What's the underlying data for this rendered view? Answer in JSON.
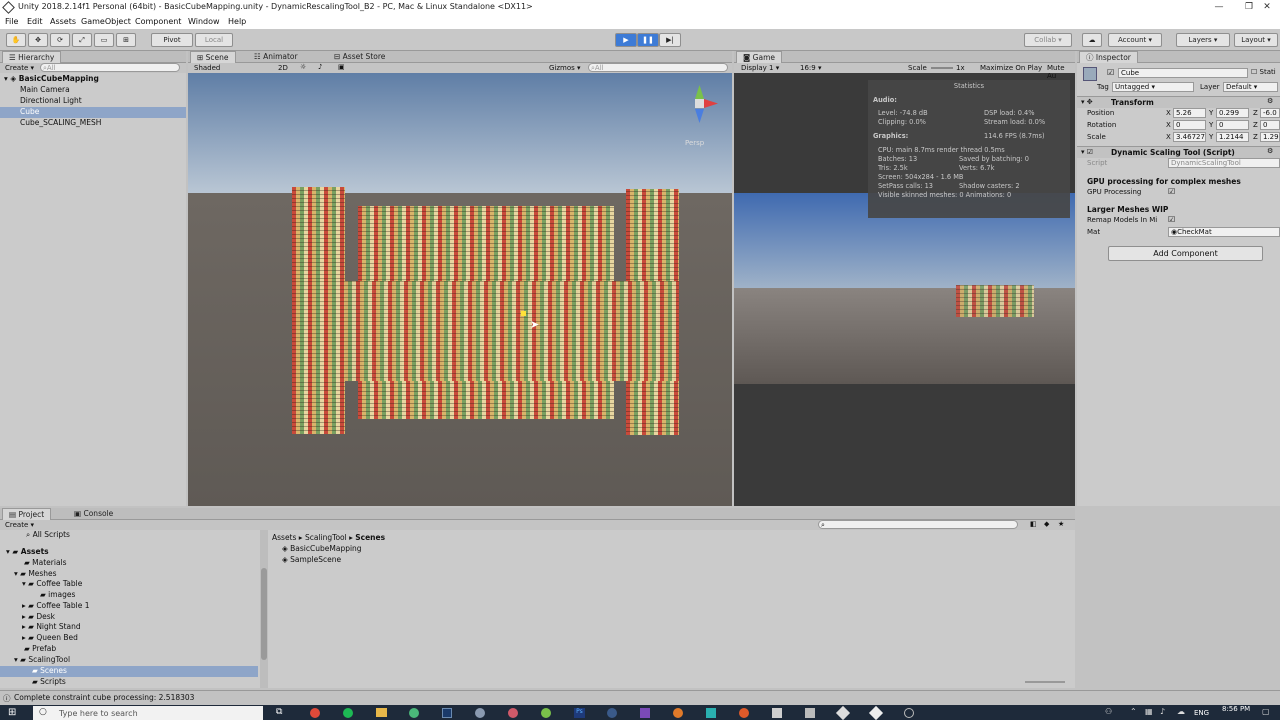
{
  "window": {
    "title": "Unity 2018.2.14f1 Personal (64bit) - BasicCubeMapping.unity - DynamicRescalingTool_B2 - PC, Mac & Linux Standalone <DX11>",
    "minimize": "—",
    "maximize": "❐",
    "close": "✕"
  },
  "menu": [
    "File",
    "Edit",
    "Assets",
    "GameObject",
    "Component",
    "Window",
    "Help"
  ],
  "toolbar": {
    "pivot": "Pivot",
    "local": "Local",
    "collab": "Collab ▾",
    "account": "Account",
    "layers": "Layers",
    "layout": "Layout"
  },
  "hierarchy": {
    "tab": "Hierarchy",
    "create": "Create",
    "search_placeholder": "All",
    "scene": "BasicCubeMapping",
    "items": [
      "Main Camera",
      "Directional Light",
      "Cube",
      "Cube_SCALING_MESH"
    ],
    "selected_index": 2
  },
  "scene_view": {
    "tabs": [
      "Scene",
      "Animator",
      "Asset Store"
    ],
    "shading": "Shaded",
    "mode_2d": "2D",
    "gizmos": "Gizmos",
    "search_placeholder": "All",
    "persp": "Persp"
  },
  "game_view": {
    "tab": "Game",
    "display": "Display 1",
    "aspect": "16:9",
    "scale_label": "Scale",
    "scale_value": "1x",
    "maximize": "Maximize On Play",
    "mute": "Mute Au"
  },
  "statistics": {
    "title": "Statistics",
    "audio_label": "Audio:",
    "level": "Level: -74.8 dB",
    "clipping": "Clipping: 0.0%",
    "dsp": "DSP load: 0.4%",
    "stream": "Stream load: 0.0%",
    "graphics_label": "Graphics:",
    "fps": "114.6 FPS (8.7ms)",
    "cpu": "CPU: main 8.7ms  render thread 0.5ms",
    "batches": "Batches: 13",
    "saved_batching": "Saved by batching: 0",
    "tris": "Tris: 2.5k",
    "verts": "Verts: 6.7k",
    "screen": "Screen: 504x284 - 1.6 MB",
    "setpass": "SetPass calls: 13",
    "shadow": "Shadow casters: 2",
    "skinned": "Visible skinned meshes: 0  Animations: 0"
  },
  "inspector": {
    "tab": "Inspector",
    "object_name": "Cube",
    "static": "Stati",
    "tag_label": "Tag",
    "tag_value": "Untagged",
    "layer_label": "Layer",
    "layer_value": "Default",
    "transform_title": "Transform",
    "position_label": "Position",
    "rotation_label": "Rotation",
    "scale_label": "Scale",
    "position": {
      "x": "5.26",
      "y": "0.299",
      "z": "-6.0"
    },
    "rotation": {
      "x": "0",
      "y": "0",
      "z": "0"
    },
    "scale": {
      "x": "3.46727",
      "y": "1.2144",
      "z": "1.29"
    },
    "script_title": "Dynamic Scaling Tool (Script)",
    "script_label": "Script",
    "script_value": "DynamicScalingTool",
    "gpu_header": "GPU processing for complex meshes",
    "gpu_label": "GPU Processing",
    "larger_header": "Larger Meshes WIP",
    "remap_label": "Remap Models In Mi",
    "mat_label": "Mat",
    "mat_value": "CheckMat",
    "add_component": "Add Component"
  },
  "project": {
    "tabs": [
      "Project",
      "Console"
    ],
    "create": "Create",
    "tree": [
      {
        "label": "All Scripts",
        "indent": 1
      },
      {
        "label": "Assets",
        "indent": 0,
        "bold": true
      },
      {
        "label": "Materials",
        "indent": 1
      },
      {
        "label": "Meshes",
        "indent": 1
      },
      {
        "label": "Coffee Table",
        "indent": 2
      },
      {
        "label": "images",
        "indent": 3
      },
      {
        "label": "Coffee Table 1",
        "indent": 2
      },
      {
        "label": "Desk",
        "indent": 2
      },
      {
        "label": "Night Stand",
        "indent": 2
      },
      {
        "label": "Queen Bed",
        "indent": 2
      },
      {
        "label": "Prefab",
        "indent": 1
      },
      {
        "label": "ScalingTool",
        "indent": 1
      },
      {
        "label": "Scenes",
        "indent": 2,
        "selected": true
      },
      {
        "label": "Scripts",
        "indent": 2
      }
    ],
    "breadcrumb": [
      "Assets",
      "ScalingTool",
      "Scenes"
    ],
    "files": [
      "BasicCubeMapping",
      "SampleScene"
    ]
  },
  "status": {
    "message": "Complete constraint cube processing: 2.518303"
  },
  "taskbar": {
    "search_placeholder": "Type here to search",
    "lang": "ENG",
    "time": "8:56 PM"
  }
}
